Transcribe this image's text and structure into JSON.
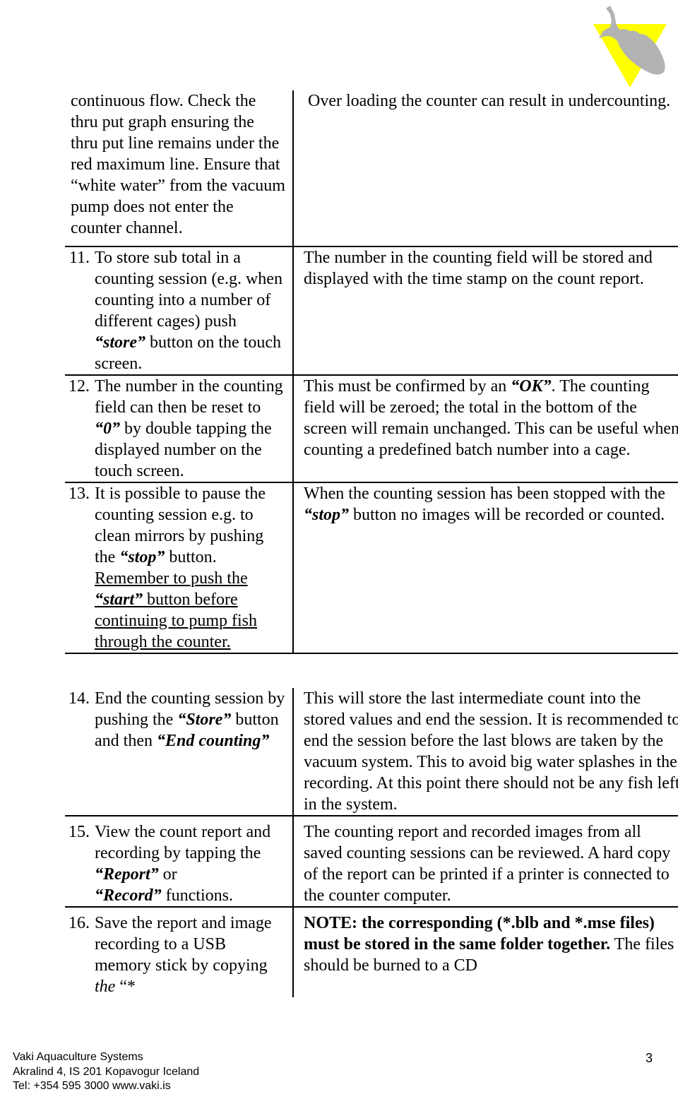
{
  "document": {
    "page_number": "3",
    "logo": {
      "name": "vaki-fish-logo",
      "triangle_color": "#ffff00",
      "fish_color": "#b3b3b3"
    }
  },
  "table_one": {
    "rows": [
      {
        "number": "",
        "left_plain": "continuous flow. Check the thru put graph ensuring the thru put line remains under the red maximum line. Ensure that “white water” from the vacuum pump does not enter the counter channel.",
        "right": "Over loading the counter can result in undercounting."
      },
      {
        "number": "11.",
        "left_pre": "To store sub total in a counting session (e.g. when counting into a number of different cages) push ",
        "left_em": "“store”",
        "left_post": " button on the touch screen.",
        "right": "The number in the counting field will be stored and displayed with the time stamp on the count report."
      },
      {
        "number": "12.",
        "left_pre": "The number in the counting field can then be reset to ",
        "left_em": "“0”",
        "left_post": " by double tapping the displayed number on the touch screen.",
        "right_pre": "This must be confirmed by an ",
        "right_em": "“OK”",
        "right_post": ".  The counting field will be zeroed; the total in the bottom of the screen will remain unchanged. This can be useful when counting a predefined batch number into a cage."
      },
      {
        "number": "13.",
        "left_pre": "It is possible to pause the counting session e.g. to clean mirrors by pushing the ",
        "left_em": "“stop”",
        "left_post": " button.",
        "left_underline_pre": "Remember to push the ",
        "left_underline_em": "“start”",
        "left_underline_post": " button before continuing to pump fish through the counter.",
        "right_pre": "When the counting session has been stopped with the ",
        "right_em": "“stop”",
        "right_post": " button no images will be recorded or counted."
      }
    ]
  },
  "table_two": {
    "rows": [
      {
        "number": "14.",
        "left_pre": "End the counting session by pushing the ",
        "left_em": "“Store”",
        "left_mid": " button and then ",
        "left_em2": "“End counting”",
        "right": "This will store the last intermediate count into the stored values and end the session.  It is recommended to end the session before the last blows are taken by the vacuum system.  This to avoid big water splashes in the recording.  At this point there should not be any fish left in the system."
      },
      {
        "number": "15.",
        "left_pre": "View the count report and recording by tapping the ",
        "left_em": "“Report”",
        "left_mid": " or ",
        "left_em2": "“Record”",
        "left_post": " functions.",
        "right": "The counting report and recorded images from all saved counting sessions can be reviewed. A hard copy of the report can be printed if a printer is connected to the counter computer."
      },
      {
        "number": "16.",
        "left_pre": "Save the report and image recording to a USB memory stick by copying ",
        "left_it": "the",
        "left_post": " “*",
        "right_bold": "NOTE:  the corresponding (*.blb and *.mse files) must be stored in the same folder together.",
        "right_post": "  The files should be burned to a CD"
      }
    ]
  },
  "footer": {
    "company": "Vaki Aquaculture Systems",
    "address": "Akralind 4, IS 201 Kopavogur Iceland",
    "contact": "Tel: +354 595 3000   www.vaki.is",
    "page_number": "3"
  }
}
